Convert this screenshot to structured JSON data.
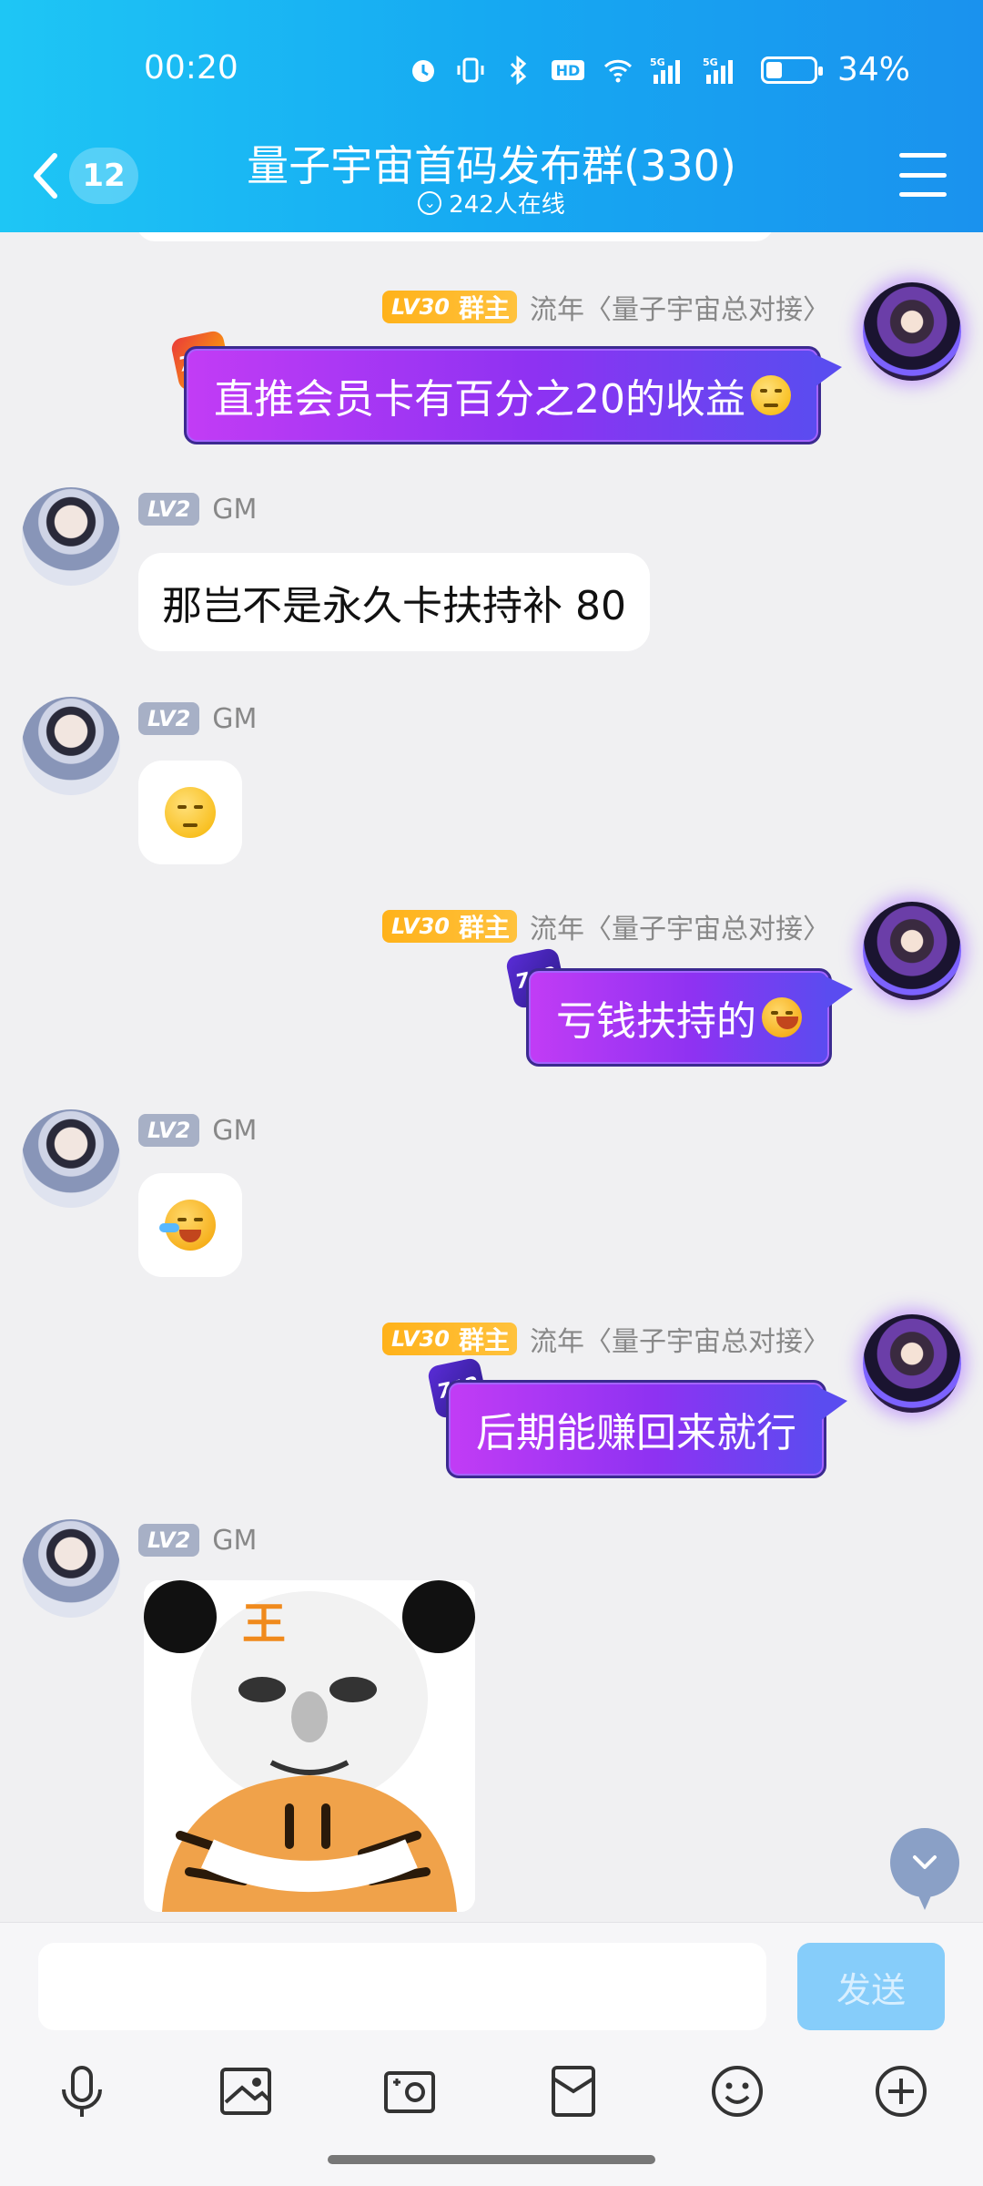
{
  "status_bar": {
    "time": "00:20",
    "battery_percent": "34%",
    "battery_level": 0.34,
    "icons": [
      "alarm-icon",
      "vibrate-icon",
      "bluetooth-icon",
      "hd-icon",
      "wifi-icon",
      "signal-5g-icon",
      "signal-5g-icon"
    ]
  },
  "header": {
    "back_badge": "12",
    "title": "量子宇宙首码发布群(330)",
    "online": "242人在线"
  },
  "messages": [
    {
      "side": "right",
      "sender": "流年〈量子宇宙总对接〉",
      "level": "LV30",
      "role": "群主",
      "text": "直推会员卡有百分之20的收益",
      "emoji": "doge-emoji"
    },
    {
      "side": "left",
      "sender": "GM",
      "level": "LV2",
      "text": "那岂不是永久卡扶持补 80"
    },
    {
      "side": "left",
      "sender": "GM",
      "level": "LV2",
      "emoji": "speechless-emoji"
    },
    {
      "side": "right",
      "sender": "流年〈量子宇宙总对接〉",
      "level": "LV30",
      "role": "群主",
      "text": "亏钱扶持的",
      "emoji": "laugh-cry-emoji"
    },
    {
      "side": "left",
      "sender": "GM",
      "level": "LV2",
      "emoji": "laugh-cry-emoji"
    },
    {
      "side": "right",
      "sender": "流年〈量子宇宙总对接〉",
      "level": "LV30",
      "role": "群主",
      "text": "后期能赚回来就行"
    },
    {
      "side": "left",
      "sender": "GM",
      "level": "LV2",
      "sticker_text": "王"
    }
  ],
  "input": {
    "placeholder": "",
    "send_label": "发送"
  },
  "toolbar": [
    "microphone-icon",
    "image-icon",
    "camera-icon",
    "red-packet-icon",
    "emoji-icon",
    "plus-icon"
  ],
  "colors": {
    "header_start": "#1ec6f5",
    "header_end": "#1a92ee",
    "bubble_purple": "#8e32f2",
    "owner_badge": "#ffb21a",
    "send_button": "#86cdfa"
  }
}
